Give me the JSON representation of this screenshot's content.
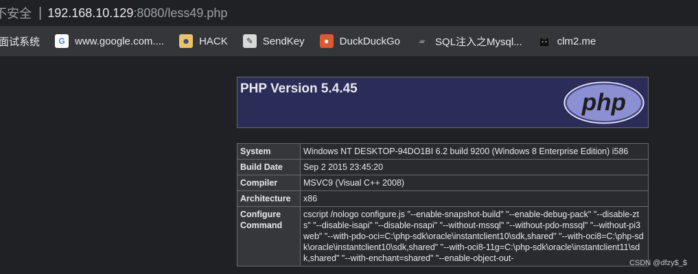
{
  "address_bar": {
    "insecure_label": "不安全",
    "host": "192.168.10.129",
    "rest": ":8080/less49.php"
  },
  "bookmarks": [
    {
      "label": "面试系统",
      "icon": "none"
    },
    {
      "label": "www.google.com....",
      "icon": "google-icon"
    },
    {
      "label": "HACK",
      "icon": "hack-icon"
    },
    {
      "label": "SendKey",
      "icon": "sendkey-icon"
    },
    {
      "label": "DuckDuckGo",
      "icon": "duckduckgo-icon"
    },
    {
      "label": "SQL注入之Mysql...",
      "icon": "sql-icon"
    },
    {
      "label": "clm2.me",
      "icon": "cat-icon"
    }
  ],
  "php": {
    "title": "PHP Version 5.4.45",
    "logo_text": "php",
    "rows": [
      {
        "key": "System",
        "value": "Windows NT DESKTOP-94DO1BI 6.2 build 9200 (Windows 8 Enterprise Edition) i586"
      },
      {
        "key": "Build Date",
        "value": "Sep 2 2015 23:45:20"
      },
      {
        "key": "Compiler",
        "value": "MSVC9 (Visual C++ 2008)"
      },
      {
        "key": "Architecture",
        "value": "x86"
      },
      {
        "key": "Configure Command",
        "value": "cscript /nologo configure.js \"--enable-snapshot-build\" \"--enable-debug-pack\" \"--disable-zts\" \"--disable-isapi\" \"--disable-nsapi\" \"--without-mssql\" \"--without-pdo-mssql\" \"--without-pi3web\" \"--with-pdo-oci=C:\\php-sdk\\oracle\\instantclient10\\sdk,shared\" \"--with-oci8=C:\\php-sdk\\oracle\\instantclient10\\sdk,shared\" \"--with-oci8-11g=C:\\php-sdk\\oracle\\instantclient11\\sdk,shared\" \"--with-enchant=shared\" \"--enable-object-out-"
      }
    ]
  },
  "watermark": "CSDN @dfzy$_$",
  "colors": {
    "header_bg": "#2b2c57",
    "key_bg": "#36373b",
    "val_bg": "#2a2b2e",
    "page_bg": "#202124"
  }
}
